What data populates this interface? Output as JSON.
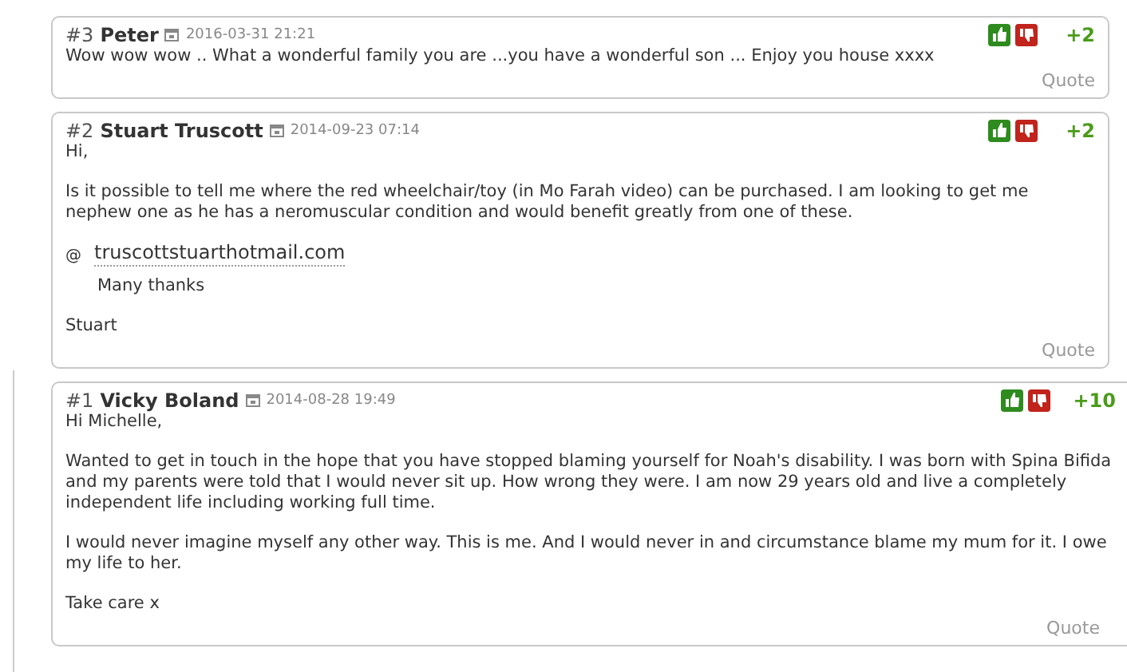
{
  "comments": [
    {
      "number": "#3",
      "author": "Peter",
      "date": "2016-03-31 21:21",
      "score": "+2",
      "quote": "Quote",
      "blocks": [
        {
          "kind": "text",
          "text": "Wow wow wow .. What a wonderful family you are ...you have a wonderful son ... Enjoy you house xxxx"
        }
      ]
    },
    {
      "number": "#2",
      "author": "Stuart Truscott",
      "date": "2014-09-23 07:14",
      "score": "+2",
      "quote": "Quote",
      "blocks": [
        {
          "kind": "text",
          "text": "Hi,"
        },
        {
          "kind": "text",
          "text": "Is it possible to tell me where the red wheelchair/toy (in Mo Farah video) can be purchased. I am looking to get me nephew one as he has a neromuscular condition and would benefit greatly from one of these."
        },
        {
          "kind": "email",
          "symbol": "@",
          "text": "truscottstuarthotmail.com"
        },
        {
          "kind": "indented",
          "text": "Many thanks"
        },
        {
          "kind": "text",
          "text": "Stuart"
        }
      ]
    },
    {
      "number": "#1",
      "author": "Vicky Boland",
      "date": "2014-08-28 19:49",
      "score": "+10",
      "quote": "Quote",
      "blocks": [
        {
          "kind": "text",
          "text": "Hi Michelle,"
        },
        {
          "kind": "text",
          "text": "Wanted to get in touch in the hope that you have stopped blaming yourself for Noah's disability. I was born with Spina Bifida and my parents were told that I would never sit up. How wrong they were. I am now 29 years old and live a completely independent life including working full time."
        },
        {
          "kind": "text",
          "text": "I would never imagine myself any other way. This is me. And I would never in and circumstance blame my mum for it. I owe my life to her."
        },
        {
          "kind": "text",
          "text": "Take care x"
        }
      ]
    }
  ]
}
